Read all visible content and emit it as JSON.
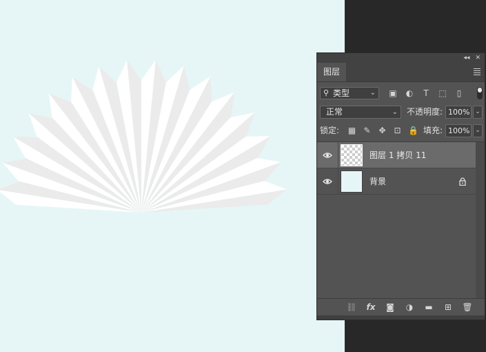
{
  "panel": {
    "tab_label": "图层",
    "collapse_glyph": "◂◂",
    "close_glyph": "✕",
    "filter": {
      "search_glyph": "⚲",
      "label": "类型",
      "chevron": "⌄"
    },
    "blend_mode": "正常",
    "opacity_label": "不透明度:",
    "opacity_value": "100%",
    "lock_label": "锁定:",
    "fill_label": "填充:",
    "fill_value": "100%",
    "chevron": "⌄",
    "filter_icons": {
      "image": "▣",
      "adjustment": "◐",
      "type": "T",
      "shape": "⬚",
      "smart": "▯"
    },
    "lock_icons": {
      "pixels": "▦",
      "brush": "✎",
      "move": "✥",
      "artboard": "⊡",
      "all": "🔒"
    },
    "layers": [
      {
        "name": "图层 1 拷贝 11",
        "selected": true,
        "thumbnail": "transparent-checker"
      },
      {
        "name": "背景",
        "selected": false,
        "thumbnail": "solid",
        "locked": true
      }
    ],
    "bottom_icons": {
      "link": "⛓",
      "fx": "fx",
      "mask": "◙",
      "adjust": "◑",
      "group": "▬",
      "new_layer": "⊞",
      "delete": "🗑"
    }
  },
  "colors": {
    "canvas_bg": "#e6f6f6",
    "fan_light": "#ffffff",
    "fan_shade": "#ebebeb",
    "panel_bg": "#535353",
    "selected_row": "#6b6b6b"
  }
}
